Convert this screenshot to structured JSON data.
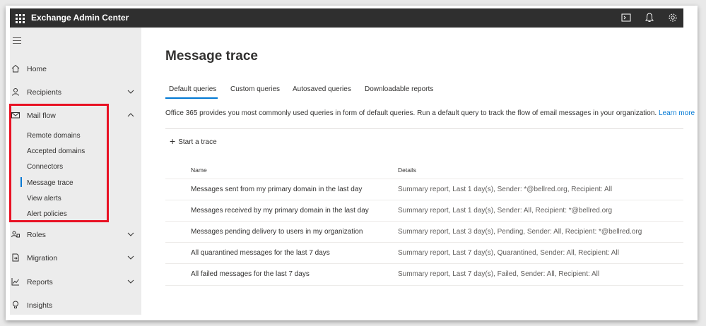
{
  "app": {
    "title": "Exchange Admin Center"
  },
  "topbar": {
    "icons": [
      "cloud-shell-icon",
      "bell-icon",
      "gear-icon"
    ]
  },
  "sidebar": {
    "items": [
      {
        "label": "Home",
        "icon": "home-icon"
      },
      {
        "label": "Recipients",
        "icon": "person-icon",
        "expanded": false
      },
      {
        "label": "Mail flow",
        "icon": "mail-icon",
        "expanded": true,
        "children": [
          {
            "label": "Remote domains"
          },
          {
            "label": "Accepted domains"
          },
          {
            "label": "Connectors"
          },
          {
            "label": "Message trace",
            "active": true
          },
          {
            "label": "View alerts"
          },
          {
            "label": "Alert policies"
          }
        ]
      },
      {
        "label": "Roles",
        "icon": "roles-icon",
        "expanded": false
      },
      {
        "label": "Migration",
        "icon": "migration-icon",
        "expanded": false
      },
      {
        "label": "Reports",
        "icon": "reports-icon",
        "expanded": false
      },
      {
        "label": "Insights",
        "icon": "lightbulb-icon"
      }
    ]
  },
  "main": {
    "title": "Message trace",
    "tabs": [
      {
        "label": "Default queries",
        "active": true
      },
      {
        "label": "Custom queries"
      },
      {
        "label": "Autosaved queries"
      },
      {
        "label": "Downloadable reports"
      }
    ],
    "description": "Office 365 provides you most commonly used queries in form of default queries. Run a default query to track the flow of email messages in your organization.",
    "learn_more": "Learn more",
    "start_trace": "Start a trace",
    "table": {
      "columns": [
        "Name",
        "Details"
      ],
      "rows": [
        {
          "name": "Messages sent from my primary domain in the last day",
          "details": "Summary report, Last 1 day(s), Sender: *@bellred.org, Recipient: All"
        },
        {
          "name": "Messages received by my primary domain in the last day",
          "details": "Summary report, Last 1 day(s), Sender: All, Recipient: *@bellred.org"
        },
        {
          "name": "Messages pending delivery to users in my organization",
          "details": "Summary report, Last 3 day(s), Pending, Sender: All, Recipient: *@bellred.org"
        },
        {
          "name": "All quarantined messages for the last 7 days",
          "details": "Summary report, Last 7 day(s), Quarantined, Sender: All, Recipient: All"
        },
        {
          "name": "All failed messages for the last 7 days",
          "details": "Summary report, Last 7 day(s), Failed, Sender: All, Recipient: All"
        }
      ]
    }
  },
  "colors": {
    "accent": "#0078d4",
    "highlight_box": "#e81123",
    "topbar": "#2f2f2f"
  }
}
